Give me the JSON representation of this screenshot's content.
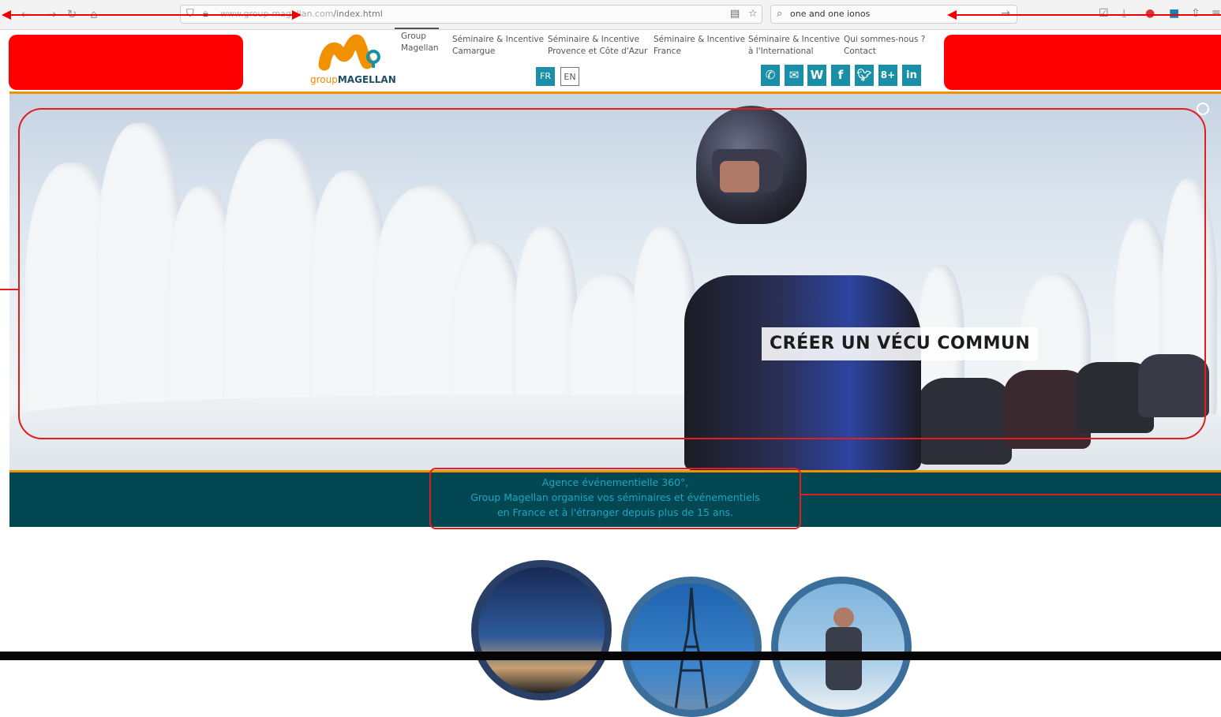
{
  "browser": {
    "url_prefix": "www.group-magellan.com",
    "url_path": "/index.html",
    "search_text": "one and one ionos"
  },
  "header": {
    "logo": {
      "prefix": "group",
      "brand": "MAGELLAN"
    },
    "menu": [
      {
        "line1": "Group",
        "line2": "Magellan"
      },
      {
        "line1": "Séminaire & Incentive",
        "line2": "Camargue"
      },
      {
        "line1": "Séminaire & Incentive",
        "line2": "Provence et Côte d'Azur"
      },
      {
        "line1": "Séminaire & Incentive",
        "line2": "France"
      },
      {
        "line1": "Séminaire & Incentive",
        "line2": "à l'International"
      },
      {
        "line1": "Qui sommes-nous ?",
        "line2": "Contact"
      }
    ],
    "languages": {
      "fr": "FR",
      "en": "EN"
    },
    "social": {
      "wordpress": "W",
      "facebook": "f",
      "googleplus": "8+",
      "linkedin": "in"
    }
  },
  "hero": {
    "caption": "CRÉER UN VÉCU COMMUN"
  },
  "banner": {
    "line1": "Agence événementielle 360°,",
    "line2": "Group Magellan organise vos séminaires et événementiels",
    "line3": "en France et à l'étranger depuis plus de 15 ans."
  },
  "colors": {
    "accent_orange": "#f29100",
    "brand_teal": "#1a8fa8",
    "banner_bg": "#034752",
    "annotation_red": "#ff0000"
  }
}
